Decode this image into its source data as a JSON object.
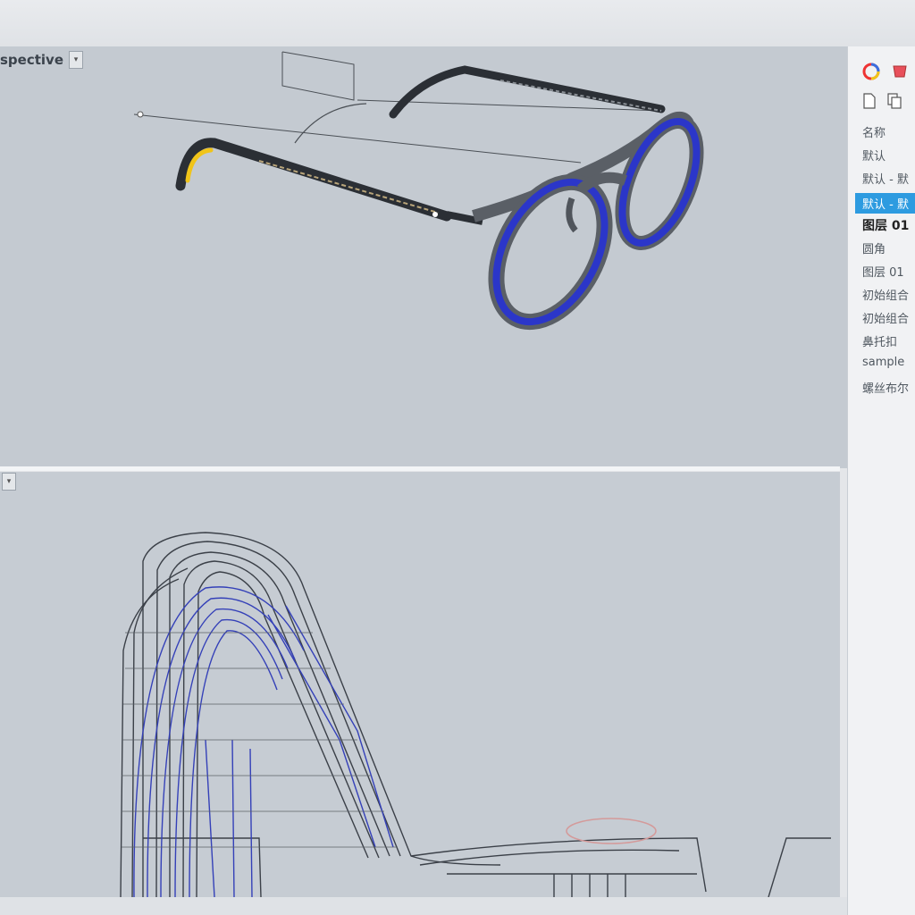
{
  "viewports": {
    "top": {
      "title": "spective",
      "dropdown_glyph": "▾"
    },
    "bottom": {
      "dropdown_glyph": "▾"
    }
  },
  "layers_panel": {
    "icons": [
      "color-wheel-icon",
      "material-icon",
      "new-file-icon",
      "copy-icon"
    ],
    "items": [
      {
        "label": "名称",
        "state": "normal"
      },
      {
        "label": "默认",
        "state": "normal"
      },
      {
        "label": "默认 - 默",
        "state": "normal"
      },
      {
        "label": "默认 - 默",
        "state": "selected"
      },
      {
        "label": "图层 01",
        "state": "bold"
      },
      {
        "label": "圆角",
        "state": "normal"
      },
      {
        "label": "图层 01",
        "state": "normal"
      },
      {
        "label": "初始组合",
        "state": "normal"
      },
      {
        "label": "初始组合",
        "state": "normal"
      },
      {
        "label": "鼻托扣",
        "state": "normal"
      },
      {
        "label": "sample",
        "state": "normal"
      },
      {
        "label": "螺丝布尔",
        "state": "normal"
      }
    ]
  },
  "colors": {
    "viewport_bg": "#c4cad1",
    "selection": "#2d9be0",
    "lens_rim": "#2b36c9",
    "frame": "#5a5f66",
    "temple_accent": "#f0c419"
  }
}
